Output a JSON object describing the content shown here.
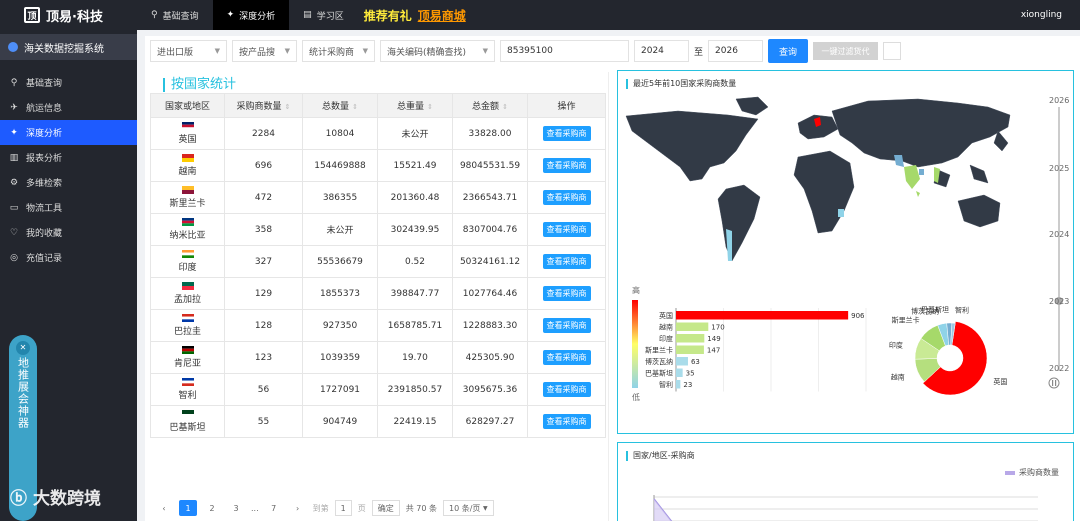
{
  "app": {
    "brand": "顶易·科技",
    "system": "海关数据挖掘系统",
    "user": "xiongling"
  },
  "topnav": [
    {
      "label": "基础查询",
      "icon": "search-icon",
      "active": false
    },
    {
      "label": "深度分析",
      "icon": "analysis-icon",
      "active": true
    },
    {
      "label": "学习区",
      "icon": "study-icon",
      "active": false
    }
  ],
  "promo": {
    "text1": "推荐有礼",
    "text2": "顶易商城"
  },
  "sidebar": [
    {
      "label": "基础查询",
      "icon": "search-icon"
    },
    {
      "label": "航运信息",
      "icon": "plane-icon"
    },
    {
      "label": "深度分析",
      "icon": "analysis-icon",
      "active": true
    },
    {
      "label": "报表分析",
      "icon": "report-icon"
    },
    {
      "label": "多维检索",
      "icon": "filter-icon"
    },
    {
      "label": "物流工具",
      "icon": "truck-icon"
    },
    {
      "label": "我的收藏",
      "icon": "heart-icon"
    },
    {
      "label": "充值记录",
      "icon": "record-icon"
    }
  ],
  "side_pill": "地推展会神器",
  "watermark": "大数跨境",
  "filters": {
    "trade": "进出口版",
    "product": "按产品搜",
    "stat": "统计采购商",
    "code_type": "海关编码(精确查找)",
    "code_value": "85395100",
    "year_from": "2024",
    "to": "至",
    "year_to": "2026",
    "query": "查询",
    "oneclick": "一键过滤货代"
  },
  "section_title": "按国家统计",
  "table": {
    "headers": [
      "国家或地区",
      "采购商数量",
      "总数量",
      "总重量",
      "总金额",
      "操作"
    ],
    "rows": [
      {
        "country": "英国",
        "flag": "gb",
        "buyers": "2284",
        "qty": "10804",
        "weight": "未公开",
        "amount": "33828.00"
      },
      {
        "country": "越南",
        "flag": "vn",
        "buyers": "696",
        "qty": "154469888",
        "weight": "15521.49",
        "amount": "98045531.59"
      },
      {
        "country": "斯里兰卡",
        "flag": "lk",
        "buyers": "472",
        "qty": "386355",
        "weight": "201360.48",
        "amount": "2366543.71"
      },
      {
        "country": "纳米比亚",
        "flag": "na",
        "buyers": "358",
        "qty": "未公开",
        "weight": "302439.95",
        "amount": "8307004.76"
      },
      {
        "country": "印度",
        "flag": "in",
        "buyers": "327",
        "qty": "55536679",
        "weight": "0.52",
        "amount": "50324161.12"
      },
      {
        "country": "孟加拉",
        "flag": "bd",
        "buyers": "129",
        "qty": "1855373",
        "weight": "398847.77",
        "amount": "1027764.46"
      },
      {
        "country": "巴拉圭",
        "flag": "py",
        "buyers": "128",
        "qty": "927350",
        "weight": "1658785.71",
        "amount": "1228883.30"
      },
      {
        "country": "肯尼亚",
        "flag": "ke",
        "buyers": "123",
        "qty": "1039359",
        "weight": "19.70",
        "amount": "425305.90"
      },
      {
        "country": "智利",
        "flag": "cl",
        "buyers": "56",
        "qty": "1727091",
        "weight": "2391850.57",
        "amount": "3095675.36"
      },
      {
        "country": "巴基斯坦",
        "flag": "pk",
        "buyers": "55",
        "qty": "904749",
        "weight": "22419.15",
        "amount": "628297.27"
      }
    ],
    "action_label": "查看采购商"
  },
  "pager": {
    "pages": [
      "1",
      "2",
      "3",
      "...",
      "7"
    ],
    "goto": "到第",
    "page_input": "1",
    "page_unit": "页",
    "confirm": "确定",
    "total": "共 70 条",
    "per_page": "10 条/页"
  },
  "map_panel": {
    "title": "最近5年前10国家采购商数量",
    "timeline": [
      "2026",
      "2025",
      "2024",
      "2023",
      "2022"
    ],
    "legend_high": "高",
    "legend_low": "低",
    "bar": {
      "categories": [
        "英国",
        "越南",
        "印度",
        "斯里兰卡",
        "博茨瓦纳",
        "巴基斯坦",
        "智利"
      ],
      "values": [
        906,
        170,
        149,
        147,
        63,
        35,
        23
      ]
    },
    "pie": {
      "labels": [
        "英国",
        "越南",
        "印度",
        "斯里兰卡",
        "博茨瓦纳",
        "巴基斯坦",
        "智利"
      ],
      "values": [
        906,
        170,
        149,
        147,
        63,
        35,
        23
      ]
    }
  },
  "trend_panel": {
    "title": "国家/地区-采购商",
    "legend": "采购商数量"
  },
  "colors": {
    "accent": "#1e88ff",
    "cyan": "#27c1df",
    "sidebar": "#23262e",
    "active": "#1e5bff",
    "red": "#ff0000"
  }
}
